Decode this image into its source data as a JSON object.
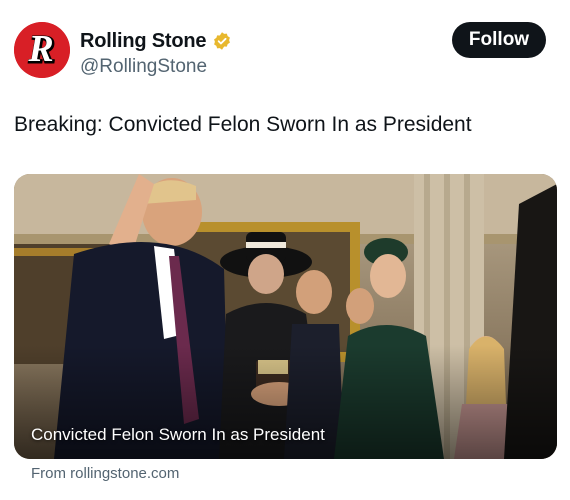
{
  "account": {
    "display_name": "Rolling Stone",
    "handle": "@RollingStone",
    "verified_badge_color": "#E8B82E",
    "avatar_color": "#D81F26",
    "avatar_letter": "R"
  },
  "follow_button": {
    "label": "Follow"
  },
  "tweet": {
    "text": "Breaking: Convicted Felon Sworn In as President"
  },
  "link_card": {
    "caption": "Convicted Felon Sworn In as President",
    "source": "From rollingstone.com"
  }
}
